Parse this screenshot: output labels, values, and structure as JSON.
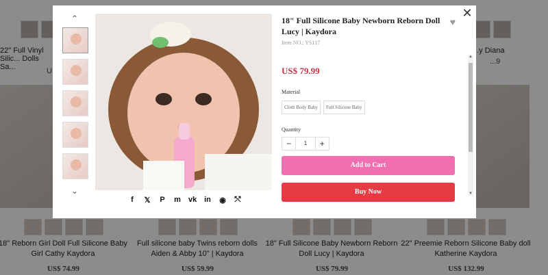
{
  "background": {
    "top_cards": [
      {
        "title": "22\" Full Vinyl Silic... Dolls Sa...",
        "price": "US$"
      },
      {
        "title": "...y Diana",
        "price": "...9"
      }
    ],
    "cards": [
      {
        "title": "18\" Reborn Girl Doll Full Silicone Baby Girl Cathy Kaydora",
        "price": "US$ 74.99"
      },
      {
        "title": "Full silicone baby Twins reborn dolls Aiden & Abby 10\" | Kaydora",
        "price": "US$ 59.99"
      },
      {
        "title": "18\" Full Silicone Baby Newborn Reborn Doll Lucy | Kaydora",
        "price": "US$ 79.99"
      },
      {
        "title": "22\" Preemie Reborn Silicone Baby doll Katherine Kaydora",
        "price": "US$ 132.99"
      }
    ]
  },
  "modal": {
    "close_label": "✕",
    "title": "18\" Full Silicone Baby Newborn Reborn Doll Lucy | Kaydora",
    "item_no": "Item NO.: YS117",
    "price": "US$ 79.99",
    "material_label": "Material",
    "material_options": [
      "Cloth Body Baby",
      "Full Silicone Baby"
    ],
    "quantity_label": "Quantity",
    "quantity_value": "1",
    "add_to_cart": "Add to Cart",
    "buy_now": "Buy Now",
    "thumb_up": "⌃",
    "thumb_down": "⌄",
    "share_icons": [
      "f",
      "𝕏",
      "P",
      "m",
      "vk",
      "in",
      "◉",
      "⤲"
    ]
  },
  "colors": {
    "price": "#c2364a",
    "add_to_cart": "#ef6fb0",
    "buy_now": "#e63a45"
  }
}
